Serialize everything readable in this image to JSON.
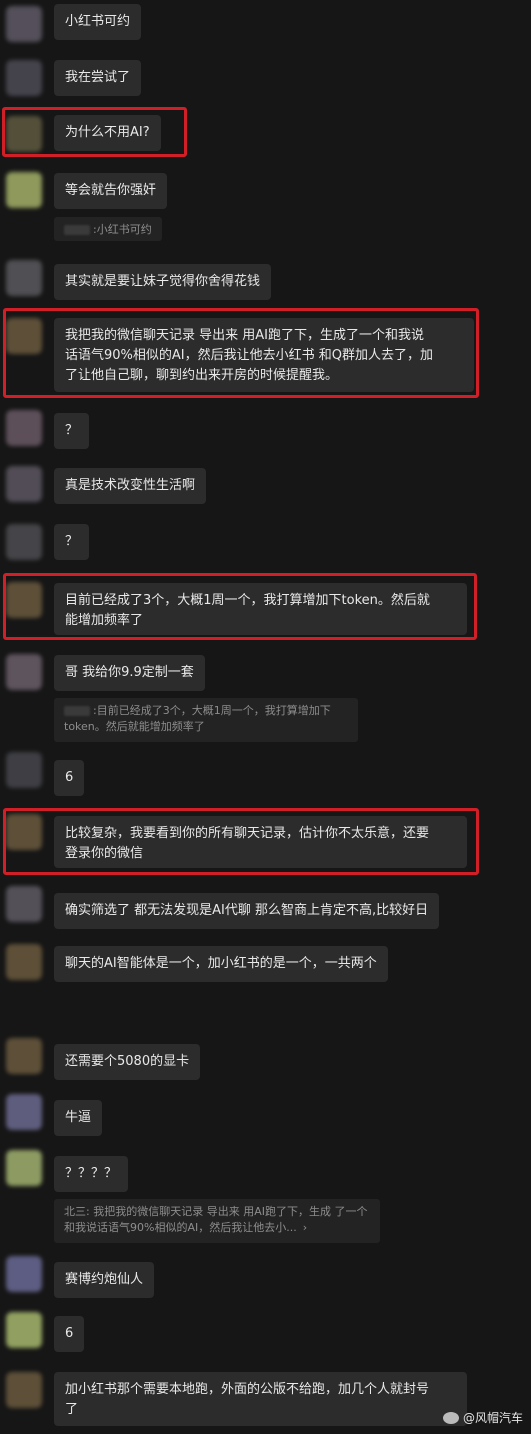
{
  "messages": [
    {
      "text": "小红书可约",
      "avatar": "#5f5a66"
    },
    {
      "text": "我在尝试了",
      "avatar": "#4d4b55"
    },
    {
      "text": "为什么不用AI?",
      "avatar": "#5f5a40"
    },
    {
      "text": "等会就告你强奸",
      "avatar": "#a3b068"
    },
    {
      "quote": "小红书可约"
    },
    {
      "text": "其实就是要让妹子觉得你舍得花钱",
      "avatar": "#5a5a5f"
    },
    {
      "text": "我把我的微信聊天记录 导出来 用AI跑了下，生成了一个和我说\n话语气90%相似的AI，然后我让他去小红书 和Q群加人去了，加\n了让他自己聊，聊到约出来开房的时候提醒我。",
      "avatar": "#6b5a3e"
    },
    {
      "text": "？",
      "avatar": "#6a5a66"
    },
    {
      "text": "真是技术改变性生活啊",
      "avatar": "#5c5661"
    },
    {
      "text": "？",
      "avatar": "#4d4d52"
    },
    {
      "text": "目前已经成了3个，大概1周一个，我打算增加下token。然后就\n能增加频率了",
      "avatar": "#6b5a3e"
    },
    {
      "text": "哥 我给你9.9定制一套",
      "avatar": "#6b5f6a"
    },
    {
      "quote": "目前已经成了3个，大概1周一个，我打算增加下\ntoken。然后就能增加频率了"
    },
    {
      "text": "6",
      "avatar": "#45464d"
    },
    {
      "text": "比较复杂，我要看到你的所有聊天记录，估计你不太乐意，还要\n登录你的微信",
      "avatar": "#6b5a3e"
    },
    {
      "text": "确实筛选了 都无法发现是AI代聊 那么智商上肯定不高,比较好日",
      "avatar": "#5f5b64"
    },
    {
      "text": "聊天的AI智能体是一个，加小红书的是一个，一共两个",
      "avatar": "#6b5a3e"
    },
    {
      "text": "还需要个5080的显卡",
      "avatar": "#6b5a3e"
    },
    {
      "text": "牛逼",
      "avatar": "#6c6a90"
    },
    {
      "text": "？？？？",
      "avatar": "#a2b370"
    },
    {
      "quote": "北三: 我把我的微信聊天记录 导出来 用AI跑了下，生成\n了一个和我说话语气90%相似的AI，然后我让他去小...",
      "chevron": "›"
    },
    {
      "text": "赛博约炮仙人",
      "avatar": "#6a6a96"
    },
    {
      "text": "6",
      "avatar": "#a7b96d"
    },
    {
      "text": "加小红书那个需要本地跑，外面的公版不给跑，加几个人就封号\n了",
      "avatar": "#6b5a3e"
    }
  ],
  "watermark": "@风帽汽车"
}
